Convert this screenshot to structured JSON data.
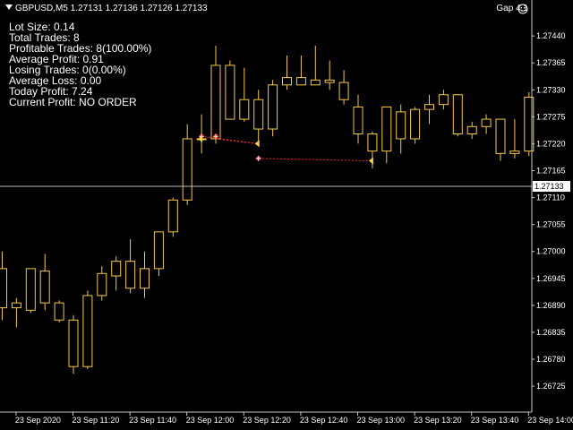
{
  "header": {
    "symbol_line": "GBPUSD,M5  1.27131 1.27136 1.27126 1.27133",
    "gap_label": "Gap 4.1"
  },
  "panel": {
    "lines": [
      "Lot Size: 0.14",
      "Total Trades: 8",
      "Profitable Trades: 8(100.00%)",
      "Average Profit: 0.91",
      "Losing  Trades: 0(0.00%)",
      "Average Loss: 0.00",
      "Today Profit: 7.24",
      "Current Profit: NO ORDER"
    ]
  },
  "colors": {
    "background": "#000000",
    "candle": "#f5c842",
    "trade_line": "#ff2a2a",
    "axis": "#c8c8c8",
    "price_line": "#c0c0c0",
    "price_label_bg": "#ffffff",
    "price_label_text": "#000000"
  },
  "chart_data": {
    "type": "candlestick",
    "symbol": "GBPUSD",
    "timeframe": "M5",
    "current_price": 1.27133,
    "current_price_label": "1.27133",
    "ylim": [
      1.26705,
      1.27475
    ],
    "y_ticks": [
      "1.27440",
      "1.27365",
      "1.27330",
      "1.27275",
      "1.27220",
      "1.27165",
      "1.27110",
      "1.27055",
      "1.27000",
      "1.26945",
      "1.26890",
      "1.26835",
      "1.26780",
      "1.26725"
    ],
    "y_tick_values": [
      1.2744,
      1.27385,
      1.2733,
      1.27275,
      1.2722,
      1.27165,
      1.2711,
      1.27055,
      1.27,
      1.26945,
      1.2689,
      1.26835,
      1.2678,
      1.26725
    ],
    "x_labels": [
      "23 Sep 2020",
      "23 Sep 11:20",
      "23 Sep 11:40",
      "23 Sep 12:00",
      "23 Sep 12:20",
      "23 Sep 12:40",
      "23 Sep 13:00",
      "23 Sep 13:20",
      "23 Sep 13:40",
      "23 Sep 14:00"
    ],
    "x_label_index": [
      1,
      5,
      9,
      13,
      17,
      21,
      25,
      29,
      33,
      37
    ],
    "candles": [
      {
        "o": 1.26965,
        "h": 1.27,
        "l": 1.2686,
        "c": 1.26885
      },
      {
        "o": 1.26885,
        "h": 1.26905,
        "l": 1.26845,
        "c": 1.26895
      },
      {
        "o": 1.2688,
        "h": 1.26965,
        "l": 1.26875,
        "c": 1.26965
      },
      {
        "o": 1.2696,
        "h": 1.26995,
        "l": 1.2688,
        "c": 1.26895
      },
      {
        "o": 1.26895,
        "h": 1.269,
        "l": 1.26855,
        "c": 1.2686
      },
      {
        "o": 1.2686,
        "h": 1.2687,
        "l": 1.2675,
        "c": 1.26765
      },
      {
        "o": 1.26765,
        "h": 1.2692,
        "l": 1.2676,
        "c": 1.2691
      },
      {
        "o": 1.2691,
        "h": 1.2697,
        "l": 1.269,
        "c": 1.26955
      },
      {
        "o": 1.2695,
        "h": 1.2699,
        "l": 1.2692,
        "c": 1.2698
      },
      {
        "o": 1.2698,
        "h": 1.27025,
        "l": 1.26915,
        "c": 1.26925
      },
      {
        "o": 1.26925,
        "h": 1.27,
        "l": 1.26905,
        "c": 1.26965
      },
      {
        "o": 1.26965,
        "h": 1.2704,
        "l": 1.2695,
        "c": 1.2704
      },
      {
        "o": 1.2704,
        "h": 1.2711,
        "l": 1.2703,
        "c": 1.27105
      },
      {
        "o": 1.27105,
        "h": 1.2726,
        "l": 1.27095,
        "c": 1.2723
      },
      {
        "o": 1.2723,
        "h": 1.2728,
        "l": 1.272,
        "c": 1.2723
      },
      {
        "o": 1.2723,
        "h": 1.2742,
        "l": 1.2722,
        "c": 1.2738
      },
      {
        "o": 1.2738,
        "h": 1.2739,
        "l": 1.2727,
        "c": 1.2727
      },
      {
        "o": 1.2727,
        "h": 1.27375,
        "l": 1.27265,
        "c": 1.2731
      },
      {
        "o": 1.2731,
        "h": 1.2733,
        "l": 1.2722,
        "c": 1.2725
      },
      {
        "o": 1.2725,
        "h": 1.2735,
        "l": 1.27235,
        "c": 1.2734
      },
      {
        "o": 1.2734,
        "h": 1.274,
        "l": 1.2733,
        "c": 1.27355
      },
      {
        "o": 1.27355,
        "h": 1.274,
        "l": 1.2734,
        "c": 1.2734
      },
      {
        "o": 1.2734,
        "h": 1.2742,
        "l": 1.2734,
        "c": 1.2735
      },
      {
        "o": 1.2735,
        "h": 1.2739,
        "l": 1.2733,
        "c": 1.27345
      },
      {
        "o": 1.27345,
        "h": 1.2737,
        "l": 1.273,
        "c": 1.2731
      },
      {
        "o": 1.27295,
        "h": 1.2732,
        "l": 1.2722,
        "c": 1.2724
      },
      {
        "o": 1.2724,
        "h": 1.27245,
        "l": 1.2717,
        "c": 1.27205
      },
      {
        "o": 1.27205,
        "h": 1.27295,
        "l": 1.2718,
        "c": 1.27295
      },
      {
        "o": 1.27285,
        "h": 1.273,
        "l": 1.272,
        "c": 1.2723
      },
      {
        "o": 1.2723,
        "h": 1.27295,
        "l": 1.2722,
        "c": 1.2729
      },
      {
        "o": 1.2729,
        "h": 1.2732,
        "l": 1.2726,
        "c": 1.273
      },
      {
        "o": 1.273,
        "h": 1.2733,
        "l": 1.2729,
        "c": 1.2732
      },
      {
        "o": 1.2732,
        "h": 1.2732,
        "l": 1.27235,
        "c": 1.2724
      },
      {
        "o": 1.2724,
        "h": 1.27265,
        "l": 1.2723,
        "c": 1.27255
      },
      {
        "o": 1.27255,
        "h": 1.2728,
        "l": 1.2724,
        "c": 1.2727
      },
      {
        "o": 1.2727,
        "h": 1.2727,
        "l": 1.27185,
        "c": 1.272
      },
      {
        "o": 1.272,
        "h": 1.2727,
        "l": 1.2719,
        "c": 1.27205
      },
      {
        "o": 1.27205,
        "h": 1.27325,
        "l": 1.27195,
        "c": 1.27315
      }
    ],
    "trades": [
      {
        "open_i": 14,
        "open_p": 1.27235,
        "close_i": 18,
        "close_p": 1.2722
      },
      {
        "open_i": 15,
        "open_p": 1.2723,
        "close_i": 18,
        "close_p": 1.2722
      },
      {
        "open_i": 18,
        "open_p": 1.2719,
        "close_i": 26,
        "close_p": 1.27185
      }
    ],
    "trade_entries": [
      {
        "i": 14,
        "p": 1.27235
      },
      {
        "i": 15,
        "p": 1.27235
      },
      {
        "i": 18,
        "p": 1.2719
      }
    ],
    "trade_exits": [
      {
        "i": 14,
        "p": 1.2723
      },
      {
        "i": 18,
        "p": 1.2722
      },
      {
        "i": 26,
        "p": 1.27185
      }
    ]
  }
}
